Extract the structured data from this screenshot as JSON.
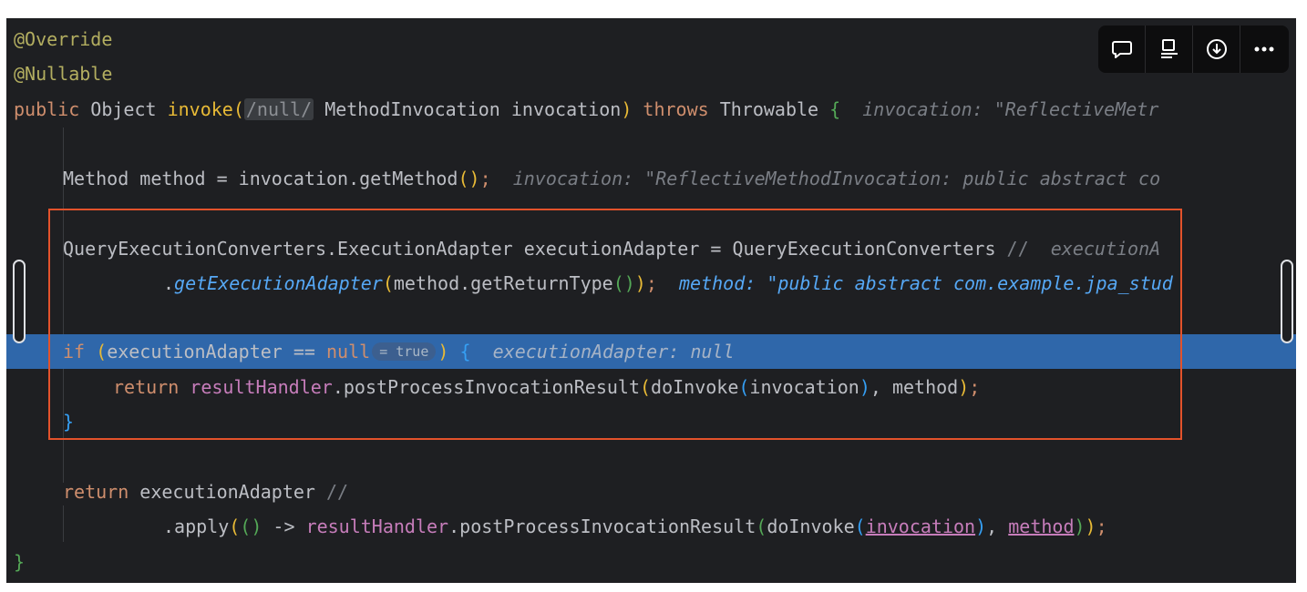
{
  "toolbar": {
    "icons": [
      "comment-icon",
      "align-icon",
      "download-icon",
      "more-icon"
    ]
  },
  "code": {
    "line1": "@Override",
    "line2": "@Nullable",
    "line3": {
      "kw_public": "public",
      "type_object": "Object",
      "fn_invoke": "invoke",
      "inlay_null": "/null/",
      "type_mi": "MethodInvocation",
      "param": "invocation",
      "kw_throws": "throws",
      "type_throwable": "Throwable",
      "brace": "{",
      "hint": "invocation: \"ReflectiveMetr"
    },
    "line4": {
      "text": "Method method = invocation.getMethod",
      "paren": "()",
      "semi": ";",
      "hint": "invocation: \"ReflectiveMethodInvocation: public abstract co"
    },
    "line5": {
      "text": "QueryExecutionConverters.ExecutionAdapter executionAdapter = QueryExecutionConverters",
      "comment": "//",
      "hint": "executionA"
    },
    "line6": {
      "dot": ".",
      "fn": "getExecutionAdapter",
      "p1": "(",
      "mid": "method.getReturnType",
      "p2": "()",
      "p3": ")",
      "semi": ";",
      "hint": "method: \"public abstract com.example.jpa_stud"
    },
    "line7": {
      "kw_if": "if",
      "p1": "(",
      "text": "executionAdapter == ",
      "null": "null",
      "badge": "= true",
      "p2": ")",
      "brace": "{",
      "hint": "executionAdapter: null"
    },
    "line8": {
      "kw_return": "return",
      "field": "resultHandler",
      "call": ".postProcessInvocationResult",
      "p1": "(",
      "fn": "doInvoke",
      "p2": "(",
      "arg": "invocation",
      "p3": ")",
      "rest": ", method",
      "p4": ")",
      "semi": ";"
    },
    "line9": "}",
    "line10": {
      "kw_return": "return",
      "text": "executionAdapter",
      "comment": "//"
    },
    "line11": {
      "dot_apply": ".apply",
      "p1": "(",
      "lambda_p": "()",
      "arrow": " -> ",
      "field": "resultHandler",
      "call": ".postProcessInvocationResult",
      "p2": "(",
      "fn": "doInvoke",
      "p3": "(",
      "arg": "invocation",
      "p4": ")",
      "comma": ", ",
      "arg2": "method",
      "p5": ")",
      "p6": ")",
      "semi": ";"
    },
    "line12": "}"
  }
}
